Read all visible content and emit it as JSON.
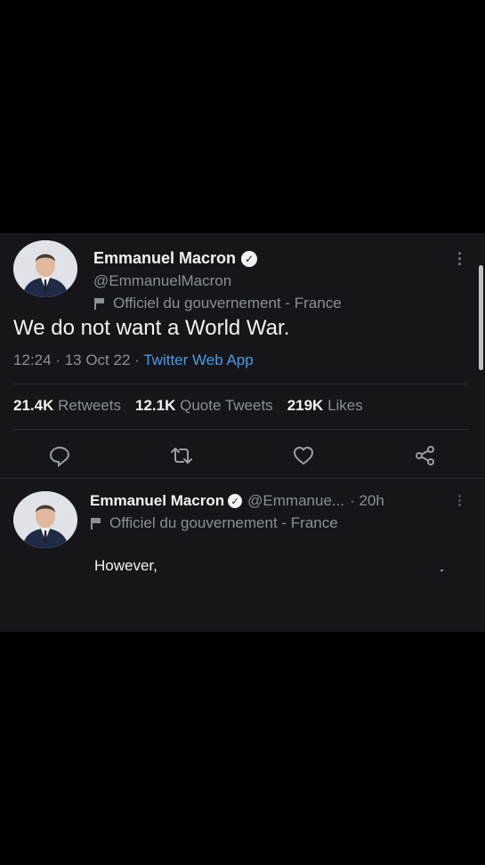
{
  "tweet": {
    "author_name": "Emmanuel Macron",
    "handle": "@EmmanuelMacron",
    "affiliation": "Officiel du gouvernement - France",
    "text": "We do not want a World War.",
    "time": "12:24",
    "date": "13 Oct 22",
    "separator": "·",
    "source": "Twitter Web App",
    "stats": {
      "retweets_count": "21.4K",
      "retweets_label": "Retweets",
      "quotes_count": "12.1K",
      "quotes_label": "Quote Tweets",
      "likes_count": "219K",
      "likes_label": "Likes"
    },
    "icons": [
      "reply-icon",
      "retweet-icon",
      "like-icon",
      "share-icon"
    ]
  },
  "reply": {
    "author_name": "Emmanuel Macron",
    "handle_truncated": "@Emmanue...",
    "age": "· 20h",
    "affiliation": "Officiel du gouvernement - France",
    "text": "However,"
  },
  "colors": {
    "background": "#000000",
    "panel": "#16161a",
    "text": "#f2f2f2",
    "muted": "#8b8f96",
    "link": "#4c9be8"
  }
}
